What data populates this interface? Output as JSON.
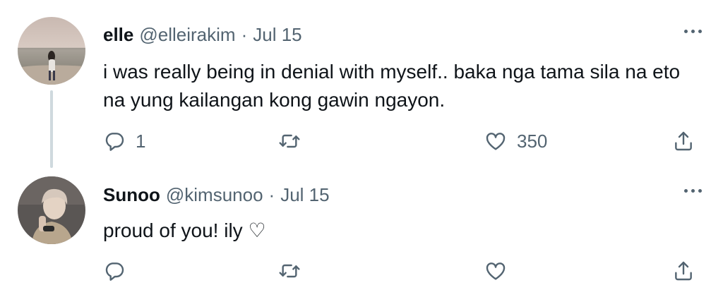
{
  "tweets": [
    {
      "name": "elle",
      "handle": "@elleirakim",
      "separator": "·",
      "date": "Jul 15",
      "text": "i was really being in denial with myself.. baka nga tama sila na eto na yung kailangan kong gawin ngayon.",
      "reply_count": "1",
      "retweet_count": "",
      "like_count": "350",
      "avatar": "beach-photo-avatar"
    },
    {
      "name": "Sunoo",
      "handle": "@kimsunoo",
      "separator": "·",
      "date": "Jul 15",
      "text": "proud of you! ily ♡",
      "reply_count": "",
      "retweet_count": "",
      "like_count": "",
      "avatar": "selfie-photo-avatar"
    }
  ],
  "icons": {
    "reply": "reply-icon",
    "retweet": "retweet-icon",
    "like": "heart-icon",
    "share": "share-icon",
    "more": "more-dots-icon"
  },
  "colors": {
    "text": "#0f1419",
    "secondary": "#536471",
    "thread_line": "#cfd9de"
  }
}
